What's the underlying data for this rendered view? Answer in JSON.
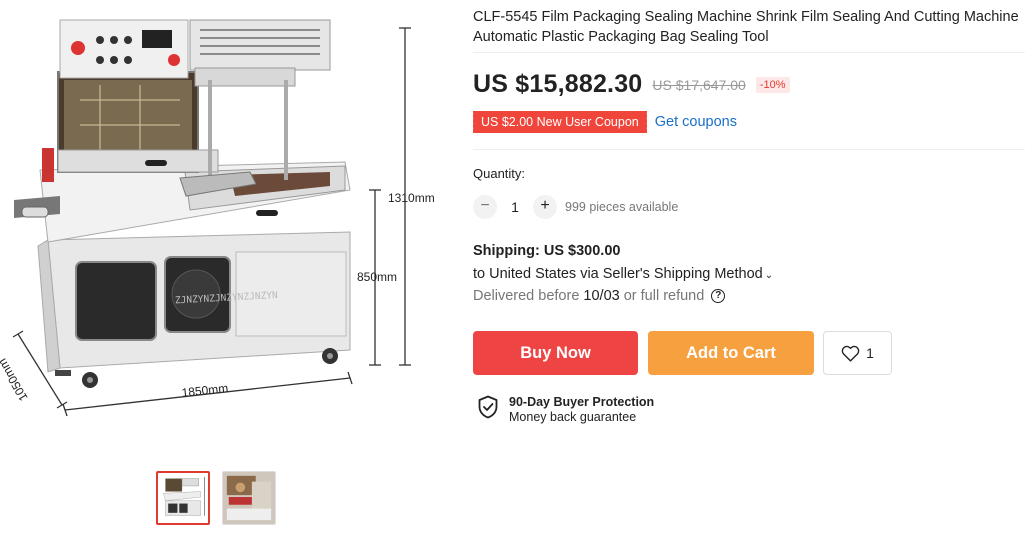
{
  "product": {
    "title": "CLF-5545 Film Packaging Sealing Machine Shrink Film Sealing And Cutting Machine Automatic Plastic Packaging Bag Sealing Tool",
    "price": "US $15,882.30",
    "original_price": "US $17,647.00",
    "discount": "-10%",
    "image_dimensions": {
      "height": "1310mm",
      "table_height": "850mm",
      "length": "1850mm",
      "depth": "1050mm",
      "watermark": "ZJNZYNZJNZYNZJNZYN"
    }
  },
  "coupon": {
    "badge": "US $2.00 New User Coupon",
    "link": "Get coupons"
  },
  "quantity": {
    "label": "Quantity:",
    "minus": "−",
    "value": "1",
    "plus": "+",
    "available": "999 pieces available"
  },
  "shipping": {
    "title": "Shipping: US $300.00",
    "destination": "to United States via Seller's Shipping Method",
    "chevron": "⌄",
    "delivery_prefix": "Delivered before",
    "delivery_date": "10/03",
    "delivery_suffix": "or full refund",
    "help": "?"
  },
  "actions": {
    "buy_now": "Buy Now",
    "add_to_cart": "Add to Cart",
    "wishlist_count": "1"
  },
  "protection": {
    "title": "90-Day Buyer Protection",
    "subtitle": "Money back guarantee"
  },
  "colors": {
    "buy_now": "#ee4444",
    "add_to_cart": "#f7a040",
    "coupon": "#f0453a",
    "link": "#1a6fc9",
    "thumb_active": "#e03a2f"
  },
  "icons": {
    "wishlist": "heart-icon",
    "protection": "shield-check-icon",
    "help": "help-circle-icon"
  }
}
